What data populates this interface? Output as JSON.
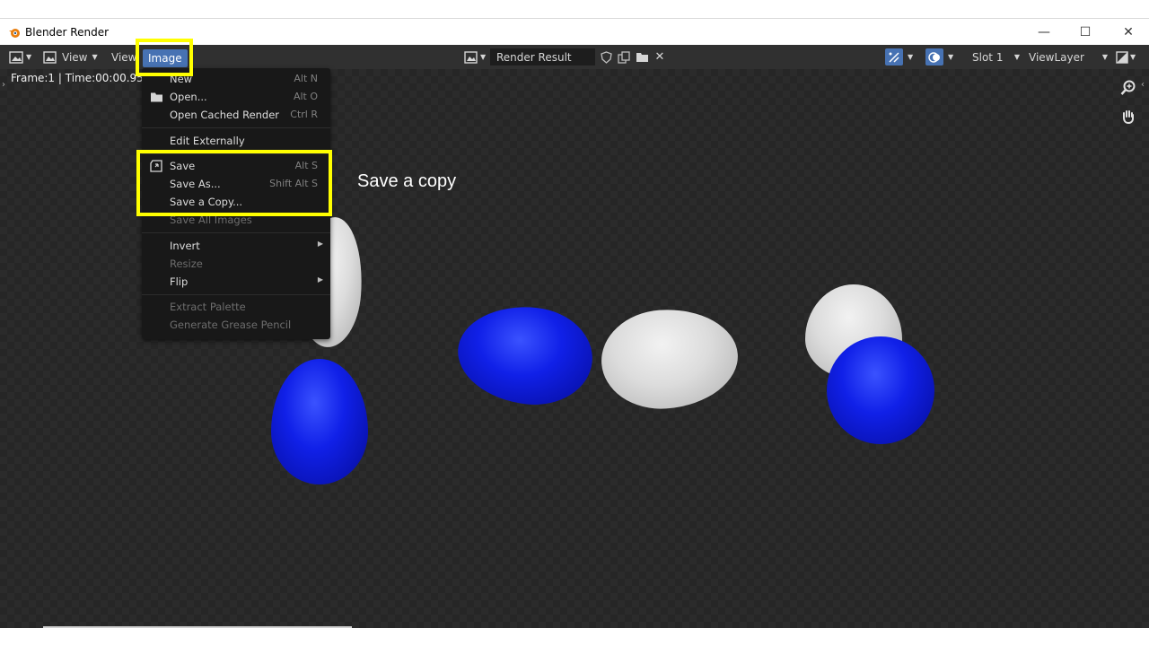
{
  "window": {
    "title": "Blender Render",
    "minimize_glyph": "—",
    "maximize_glyph": "☐",
    "close_glyph": "✕"
  },
  "header": {
    "editor_type_icon": "image-editor-icon",
    "view_menu": "View",
    "view_menu_2": "View",
    "image_menu": "Image",
    "image_name": "Render Result",
    "slot": "Slot 1",
    "view_layer": "ViewLayer"
  },
  "viewport": {
    "frame_info": "Frame:1 | Time:00:00.95 | M"
  },
  "image_menu": {
    "items": [
      {
        "label": "New",
        "shortcut": "Alt N",
        "enabled": true
      },
      {
        "label": "Open...",
        "shortcut": "Alt O",
        "enabled": true,
        "icon": "folder-icon"
      },
      {
        "label": "Open Cached Render",
        "shortcut": "Ctrl R",
        "enabled": true
      },
      {
        "label": "Edit Externally",
        "shortcut": "",
        "enabled": true
      },
      {
        "label": "Save",
        "shortcut": "Alt S",
        "enabled": true,
        "icon": "save-icon"
      },
      {
        "label": "Save As...",
        "shortcut": "Shift Alt S",
        "enabled": true
      },
      {
        "label": "Save a Copy...",
        "shortcut": "",
        "enabled": true
      },
      {
        "label": "Save All Images",
        "shortcut": "",
        "enabled": false
      },
      {
        "label": "Invert",
        "shortcut": "",
        "enabled": true,
        "submenu": true
      },
      {
        "label": "Resize",
        "shortcut": "",
        "enabled": false
      },
      {
        "label": "Flip",
        "shortcut": "",
        "enabled": true,
        "submenu": true
      },
      {
        "label": "Extract Palette",
        "shortcut": "",
        "enabled": false
      },
      {
        "label": "Generate Grease Pencil",
        "shortcut": "",
        "enabled": false
      }
    ]
  },
  "annotation": {
    "text": "Save a copy",
    "highlight_color": "#ffff00"
  },
  "colors": {
    "menu_bg": "#181818",
    "header_bg": "#303030",
    "active_menu": "#4772b3",
    "egg_blue": "#1020e8",
    "egg_white": "#dcdcdc"
  }
}
